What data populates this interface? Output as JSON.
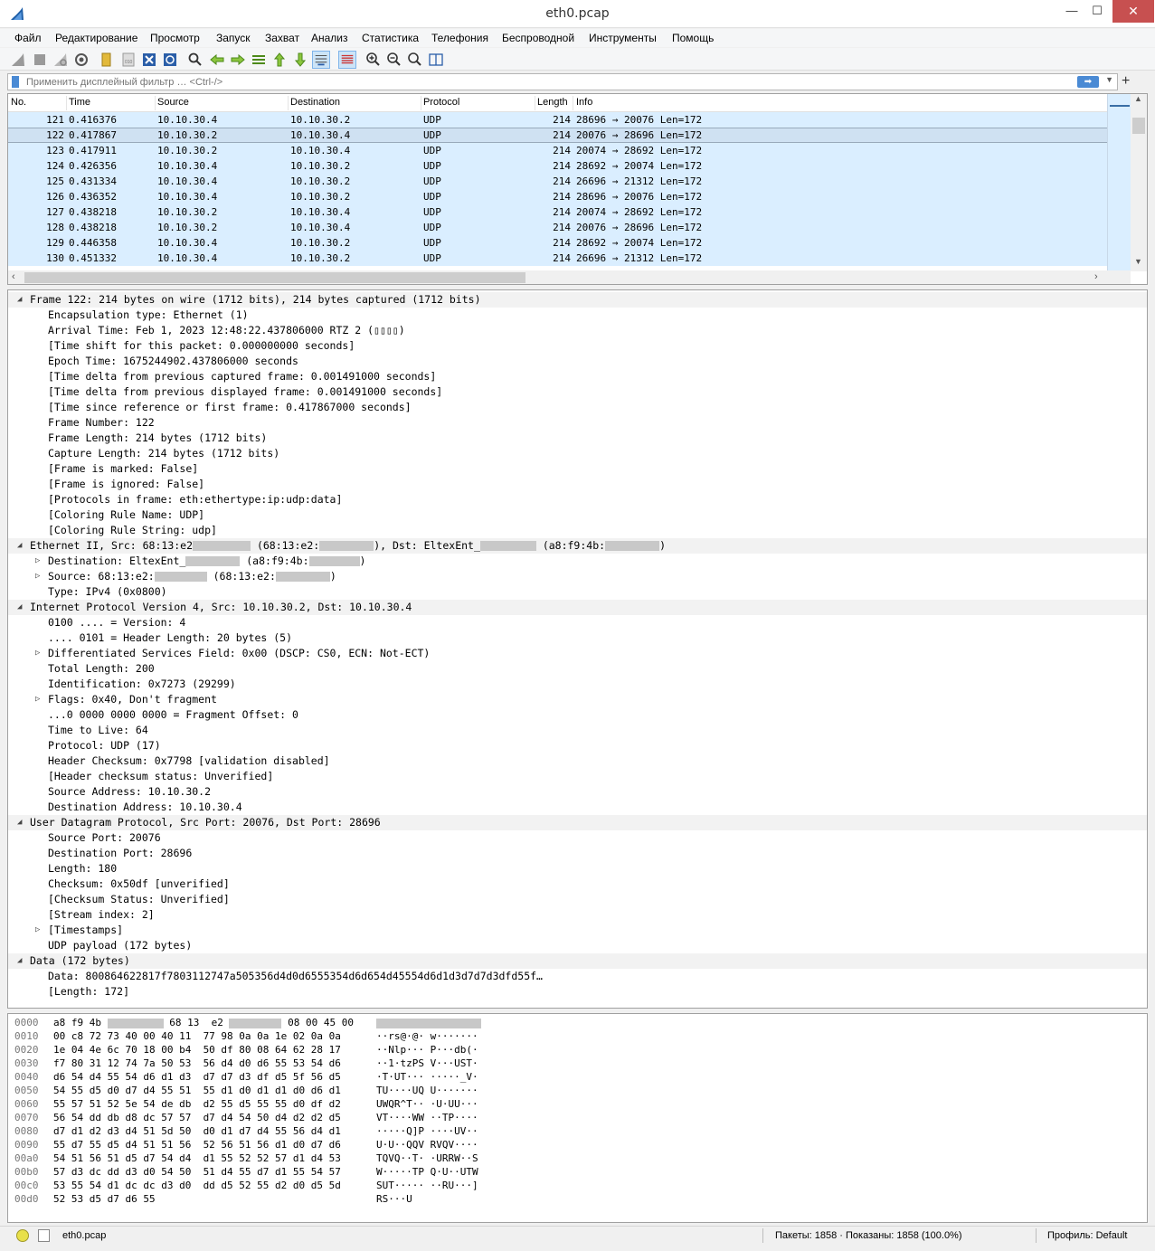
{
  "window": {
    "title": "eth0.pcap",
    "min_label": "—",
    "max_label": "☐",
    "close_label": "✕"
  },
  "menu": [
    "Файл",
    "Редактирование",
    "Просмотр",
    "Запуск",
    "Захват",
    "Анализ",
    "Статистика",
    "Телефония",
    "Беспроводной",
    "Инструменты",
    "Помощь"
  ],
  "toolbar_icons": [
    "shark-fin-start-icon",
    "stop-icon",
    "restart-icon",
    "options-gear-icon",
    "open-folder-icon",
    "save-file-icon",
    "close-file-icon",
    "reload-icon",
    "find-packet-icon",
    "go-back-icon",
    "go-forward-icon",
    "go-to-packet-icon",
    "go-first-icon",
    "go-last-icon",
    "autoscroll-icon",
    "colorize-icon",
    "zoom-in-icon",
    "zoom-out-icon",
    "zoom-normal-icon",
    "resize-columns-icon"
  ],
  "filter": {
    "placeholder": "Применить дисплейный фильтр … <Ctrl-/>",
    "value": "",
    "apply_label": "➡",
    "plus_label": "+"
  },
  "packet_list": {
    "columns": [
      "No.",
      "Time",
      "Source",
      "Destination",
      "Protocol",
      "Length",
      "Info"
    ],
    "selected_index": 1,
    "row_color": "#daeeff",
    "rows": [
      [
        "121",
        "0.416376",
        "10.10.30.4",
        "10.10.30.2",
        "UDP",
        "214",
        "28696 → 20076 Len=172"
      ],
      [
        "122",
        "0.417867",
        "10.10.30.2",
        "10.10.30.4",
        "UDP",
        "214",
        "20076 → 28696 Len=172"
      ],
      [
        "123",
        "0.417911",
        "10.10.30.2",
        "10.10.30.4",
        "UDP",
        "214",
        "20074 → 28692 Len=172"
      ],
      [
        "124",
        "0.426356",
        "10.10.30.4",
        "10.10.30.2",
        "UDP",
        "214",
        "28692 → 20074 Len=172"
      ],
      [
        "125",
        "0.431334",
        "10.10.30.4",
        "10.10.30.2",
        "UDP",
        "214",
        "26696 → 21312 Len=172"
      ],
      [
        "126",
        "0.436352",
        "10.10.30.4",
        "10.10.30.2",
        "UDP",
        "214",
        "28696 → 20076 Len=172"
      ],
      [
        "127",
        "0.438218",
        "10.10.30.2",
        "10.10.30.4",
        "UDP",
        "214",
        "20074 → 28692 Len=172"
      ],
      [
        "128",
        "0.438218",
        "10.10.30.2",
        "10.10.30.4",
        "UDP",
        "214",
        "20076 → 28696 Len=172"
      ],
      [
        "129",
        "0.446358",
        "10.10.30.4",
        "10.10.30.2",
        "UDP",
        "214",
        "28692 → 20074 Len=172"
      ],
      [
        "130",
        "0.451332",
        "10.10.30.4",
        "10.10.30.2",
        "UDP",
        "214",
        "26696 → 21312 Len=172"
      ]
    ]
  },
  "details": [
    {
      "level": 0,
      "tw": "open",
      "text": "Frame 122: 214 bytes on wire (1712 bits), 214 bytes captured (1712 bits)"
    },
    {
      "level": 1,
      "tw": "",
      "text": "Encapsulation type: Ethernet (1)"
    },
    {
      "level": 1,
      "tw": "",
      "text": "Arrival Time: Feb  1, 2023 12:48:22.437806000 RTZ 2 (▯▯▯▯)"
    },
    {
      "level": 1,
      "tw": "",
      "text": "[Time shift for this packet: 0.000000000 seconds]"
    },
    {
      "level": 1,
      "tw": "",
      "text": "Epoch Time: 1675244902.437806000 seconds"
    },
    {
      "level": 1,
      "tw": "",
      "text": "[Time delta from previous captured frame: 0.001491000 seconds]"
    },
    {
      "level": 1,
      "tw": "",
      "text": "[Time delta from previous displayed frame: 0.001491000 seconds]"
    },
    {
      "level": 1,
      "tw": "",
      "text": "[Time since reference or first frame: 0.417867000 seconds]"
    },
    {
      "level": 1,
      "tw": "",
      "text": "Frame Number: 122"
    },
    {
      "level": 1,
      "tw": "",
      "text": "Frame Length: 214 bytes (1712 bits)"
    },
    {
      "level": 1,
      "tw": "",
      "text": "Capture Length: 214 bytes (1712 bits)"
    },
    {
      "level": 1,
      "tw": "",
      "text": "[Frame is marked: False]"
    },
    {
      "level": 1,
      "tw": "",
      "text": "[Frame is ignored: False]"
    },
    {
      "level": 1,
      "tw": "",
      "text": "[Protocols in frame: eth:ethertype:ip:udp:data]"
    },
    {
      "level": 1,
      "tw": "",
      "text": "[Coloring Rule Name: UDP]"
    },
    {
      "level": 1,
      "tw": "",
      "text": "[Coloring Rule String: udp]"
    },
    {
      "level": 0,
      "tw": "open",
      "parts": [
        "Ethernet II, Src: 68:13:e2",
        "#R64",
        " (68:13:e2:",
        "#R60",
        "), Dst: EltexEnt_",
        "#R62",
        " (a8:f9:4b:",
        "#R60",
        ")"
      ]
    },
    {
      "level": 1,
      "tw": "closed",
      "parts": [
        "Destination: EltexEnt_",
        "#R60",
        " (a8:f9:4b:",
        "#R56",
        ")"
      ]
    },
    {
      "level": 1,
      "tw": "closed",
      "parts": [
        "Source: 68:13:e2:",
        "#R58",
        " (68:13:e2:",
        "#R60",
        ")"
      ]
    },
    {
      "level": 1,
      "tw": "",
      "text": "Type: IPv4 (0x0800)"
    },
    {
      "level": 0,
      "tw": "open",
      "text": "Internet Protocol Version 4, Src: 10.10.30.2, Dst: 10.10.30.4"
    },
    {
      "level": 1,
      "tw": "",
      "text": "0100 .... = Version: 4"
    },
    {
      "level": 1,
      "tw": "",
      "text": ".... 0101 = Header Length: 20 bytes (5)"
    },
    {
      "level": 1,
      "tw": "closed",
      "text": "Differentiated Services Field: 0x00 (DSCP: CS0, ECN: Not-ECT)"
    },
    {
      "level": 1,
      "tw": "",
      "text": "Total Length: 200"
    },
    {
      "level": 1,
      "tw": "",
      "text": "Identification: 0x7273 (29299)"
    },
    {
      "level": 1,
      "tw": "closed",
      "text": "Flags: 0x40, Don't fragment"
    },
    {
      "level": 1,
      "tw": "",
      "text": "...0 0000 0000 0000 = Fragment Offset: 0"
    },
    {
      "level": 1,
      "tw": "",
      "text": "Time to Live: 64"
    },
    {
      "level": 1,
      "tw": "",
      "text": "Protocol: UDP (17)"
    },
    {
      "level": 1,
      "tw": "",
      "text": "Header Checksum: 0x7798 [validation disabled]"
    },
    {
      "level": 1,
      "tw": "",
      "text": "[Header checksum status: Unverified]"
    },
    {
      "level": 1,
      "tw": "",
      "text": "Source Address: 10.10.30.2"
    },
    {
      "level": 1,
      "tw": "",
      "text": "Destination Address: 10.10.30.4"
    },
    {
      "level": 0,
      "tw": "open",
      "text": "User Datagram Protocol, Src Port: 20076, Dst Port: 28696"
    },
    {
      "level": 1,
      "tw": "",
      "text": "Source Port: 20076"
    },
    {
      "level": 1,
      "tw": "",
      "text": "Destination Port: 28696"
    },
    {
      "level": 1,
      "tw": "",
      "text": "Length: 180"
    },
    {
      "level": 1,
      "tw": "",
      "text": "Checksum: 0x50df [unverified]"
    },
    {
      "level": 1,
      "tw": "",
      "text": "[Checksum Status: Unverified]"
    },
    {
      "level": 1,
      "tw": "",
      "text": "[Stream index: 2]"
    },
    {
      "level": 1,
      "tw": "closed",
      "text": "[Timestamps]"
    },
    {
      "level": 1,
      "tw": "",
      "text": "UDP payload (172 bytes)"
    },
    {
      "level": 0,
      "tw": "open",
      "text": "Data (172 bytes)"
    },
    {
      "level": 1,
      "tw": "",
      "text": "Data: 800864622817f7803112747a505356d4d0d6555354d6d654d45554d6d1d3d7d7d3dfd55f…"
    },
    {
      "level": 1,
      "tw": "",
      "text": "[Length: 172]"
    }
  ],
  "bytes": [
    {
      "off": "0000",
      "hex": [
        "a8 f9 4b ",
        "#R62",
        " 68 13  e2 ",
        "#R58",
        " 08 00 45 00"
      ],
      "asc": [
        "#R116"
      ]
    },
    {
      "off": "0010",
      "hex": [
        "00 c8 72 73 40 00 40 11  77 98 0a 0a 1e 02 0a 0a"
      ],
      "asc": [
        "··rs@·@· w·······"
      ]
    },
    {
      "off": "0020",
      "hex": [
        "1e 04 4e 6c 70 18 00 b4  50 df 80 08 64 62 28 17"
      ],
      "asc": [
        "··Nlp··· P···db(·"
      ]
    },
    {
      "off": "0030",
      "hex": [
        "f7 80 31 12 74 7a 50 53  56 d4 d0 d6 55 53 54 d6"
      ],
      "asc": [
        "··1·tzPS V···UST·"
      ]
    },
    {
      "off": "0040",
      "hex": [
        "d6 54 d4 55 54 d6 d1 d3  d7 d7 d3 df d5 5f 56 d5"
      ],
      "asc": [
        "·T·UT··· ·····_V·"
      ]
    },
    {
      "off": "0050",
      "hex": [
        "54 55 d5 d0 d7 d4 55 51  55 d1 d0 d1 d1 d0 d6 d1"
      ],
      "asc": [
        "TU····UQ U·······"
      ]
    },
    {
      "off": "0060",
      "hex": [
        "55 57 51 52 5e 54 de db  d2 55 d5 55 55 d0 df d2"
      ],
      "asc": [
        "UWQR^T·· ·U·UU···"
      ]
    },
    {
      "off": "0070",
      "hex": [
        "56 54 dd db d8 dc 57 57  d7 d4 54 50 d4 d2 d2 d5"
      ],
      "asc": [
        "VT····WW ··TP····"
      ]
    },
    {
      "off": "0080",
      "hex": [
        "d7 d1 d2 d3 d4 51 5d 50  d0 d1 d7 d4 55 56 d4 d1"
      ],
      "asc": [
        "·····Q]P ····UV··"
      ]
    },
    {
      "off": "0090",
      "hex": [
        "55 d7 55 d5 d4 51 51 56  52 56 51 56 d1 d0 d7 d6"
      ],
      "asc": [
        "U·U··QQV RVQV····"
      ]
    },
    {
      "off": "00a0",
      "hex": [
        "54 51 56 51 d5 d7 54 d4  d1 55 52 52 57 d1 d4 53"
      ],
      "asc": [
        "TQVQ··T· ·URRW··S"
      ]
    },
    {
      "off": "00b0",
      "hex": [
        "57 d3 dc dd d3 d0 54 50  51 d4 55 d7 d1 55 54 57"
      ],
      "asc": [
        "W·····TP Q·U··UTW"
      ]
    },
    {
      "off": "00c0",
      "hex": [
        "53 55 54 d1 dc dc d3 d0  dd d5 52 55 d2 d0 d5 5d"
      ],
      "asc": [
        "SUT····· ··RU···]"
      ]
    },
    {
      "off": "00d0",
      "hex": [
        "52 53 d5 d7 d6 55"
      ],
      "asc": [
        "RS···U"
      ]
    }
  ],
  "status": {
    "file": "eth0.pcap",
    "packets": "Пакеты: 1858 · Показаны: 1858 (100.0%)",
    "profile": "Профиль: Default"
  }
}
